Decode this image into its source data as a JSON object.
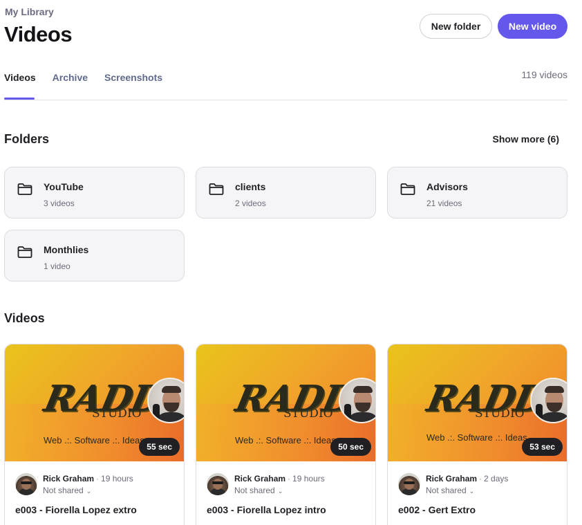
{
  "breadcrumb": "My Library",
  "page_title": "Videos",
  "actions": {
    "new_folder": "New folder",
    "new_video": "New video"
  },
  "tabs": [
    {
      "label": "Videos",
      "active": true
    },
    {
      "label": "Archive",
      "active": false
    },
    {
      "label": "Screenshots",
      "active": false
    }
  ],
  "video_count": "119 videos",
  "folders_section": {
    "title": "Folders",
    "show_more": "Show more (6)"
  },
  "folders": [
    {
      "name": "YouTube",
      "count": "3 videos",
      "icon": "folder-icon"
    },
    {
      "name": "clients",
      "count": "2 videos",
      "icon": "folder-icon"
    },
    {
      "name": "Advisors",
      "count": "21 videos",
      "icon": "folder-icon"
    },
    {
      "name": "Monthlies",
      "count": "1 video",
      "icon": "folder-icon"
    }
  ],
  "videos_section": {
    "title": "Videos"
  },
  "videos": [
    {
      "duration": "55 sec",
      "author": "Rick Graham",
      "time_ago": "19 hours",
      "share_status": "Not shared",
      "title": "e003 - Fiorella Lopez extro",
      "thumb": {
        "logo": "RADD",
        "studio": "STUDIO",
        "tagline": "Web .:. Software .:. Ideas"
      }
    },
    {
      "duration": "50 sec",
      "author": "Rick Graham",
      "time_ago": "19 hours",
      "share_status": "Not shared",
      "title": "e003 - Fiorella Lopez intro",
      "thumb": {
        "logo": "RADD",
        "studio": "STUDIO",
        "tagline": "Web .:. Software .:. Ideas"
      }
    },
    {
      "duration": "53 sec",
      "author": "Rick Graham",
      "time_ago": "2 days",
      "share_status": "Not shared",
      "title": "e002 - Gert Extro",
      "thumb": {
        "logo": "RADD",
        "studio": "STUDIO",
        "tagline": "Web .:. Software .:. Ideas"
      }
    }
  ],
  "colors": {
    "accent": "#6457ec",
    "folder_bg": "#f5f5f7",
    "duration_bg": "#1f1f24"
  }
}
